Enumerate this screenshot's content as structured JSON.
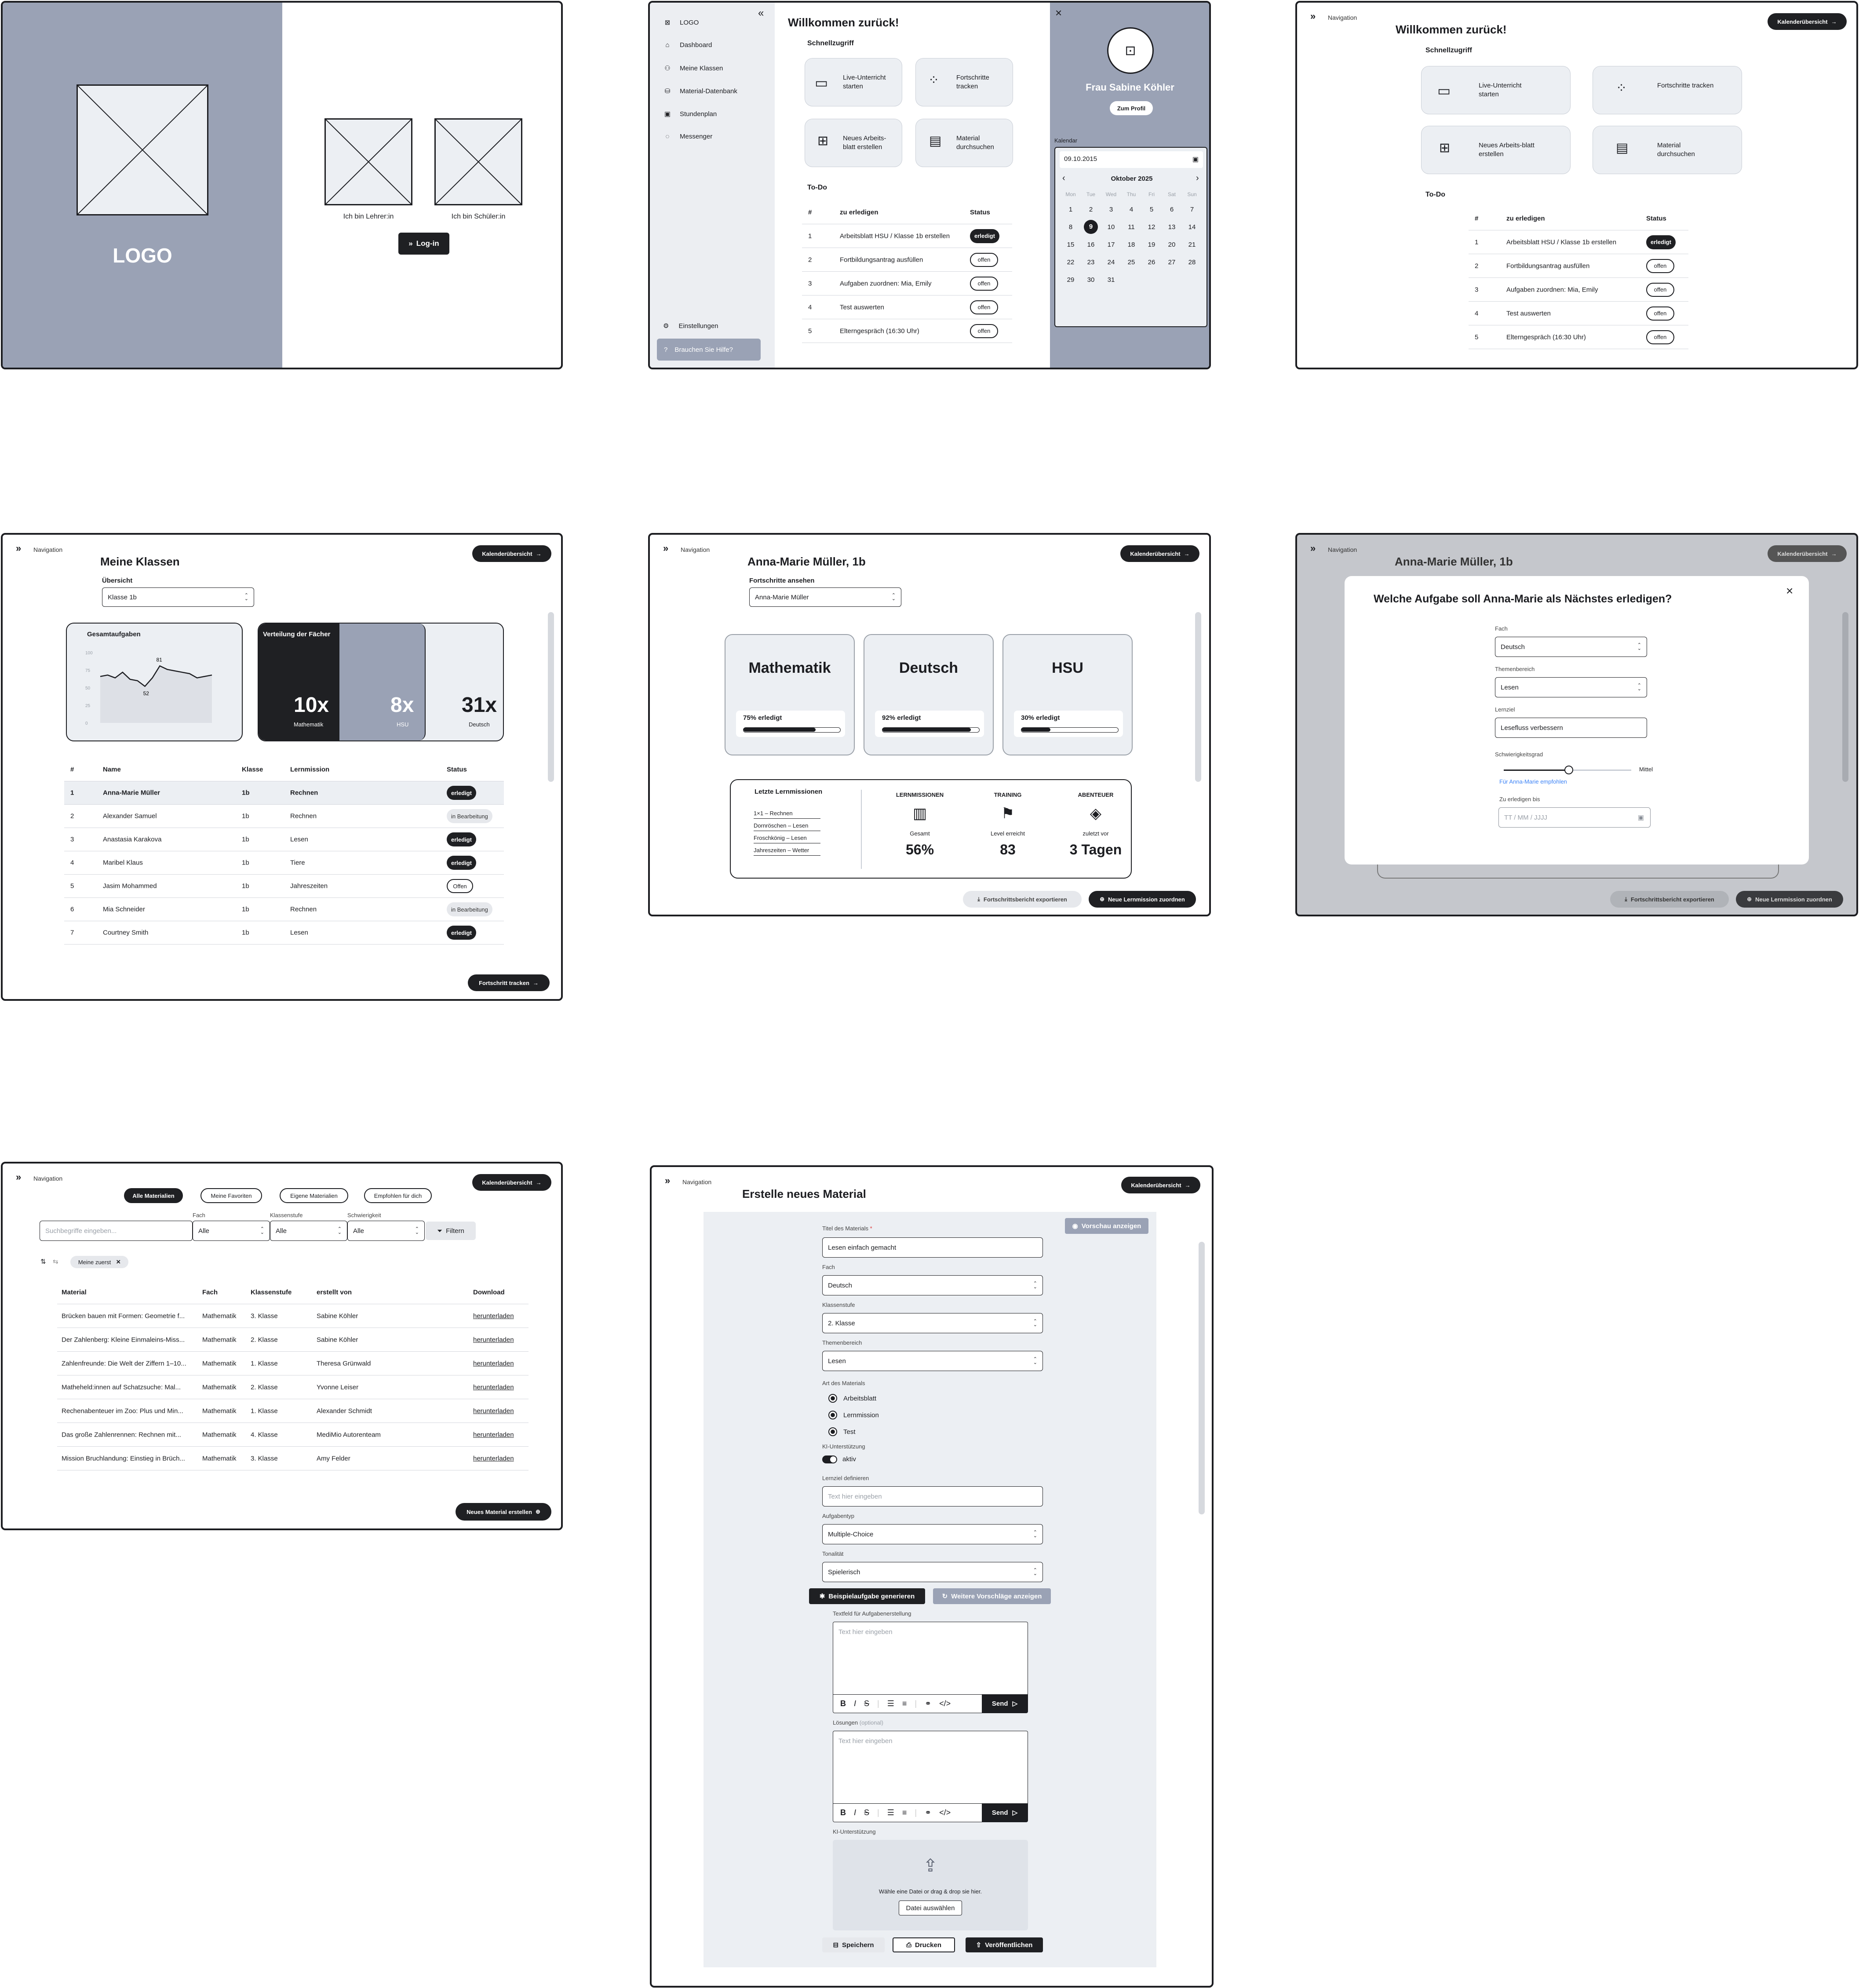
{
  "login": {
    "logo": "LOGO",
    "teacher": "Ich bin Lehrer:in",
    "student": "Ich bin Schüler:in",
    "login_btn": "Log-in"
  },
  "dash": {
    "sidebar": [
      "LOGO",
      "Dashboard",
      "Meine Klassen",
      "Material-Datenbank",
      "Stundenplan",
      "Messenger"
    ],
    "settings": "Einstellungen",
    "help": "Brauchen Sie Hilfe?",
    "welcome": "Willkommen zurück!",
    "quick": "Schnellzugriff",
    "tiles": [
      "Live-Unterricht starten",
      "Fortschritte tracken",
      "Neues Arbeits-blatt erstellen",
      "Material durchsuchen"
    ],
    "todo": "To-Do",
    "cols": [
      "#",
      "zu erledigen",
      "Status"
    ],
    "rows": [
      [
        "1",
        "Arbeitsblatt HSU / Klasse 1b erstellen",
        "erledigt"
      ],
      [
        "2",
        "Fortbildungsantrag ausfüllen",
        "offen"
      ],
      [
        "3",
        "Aufgaben zuordnen: Mia, Emily",
        "offen"
      ],
      [
        "4",
        "Test auswerten",
        "offen"
      ],
      [
        "5",
        "Elterngespräch (16:30 Uhr)",
        "offen"
      ]
    ],
    "profile_name": "Frau Sabine Köhler",
    "profile_btn": "Zum Profil",
    "kal": "Kalendar",
    "date": "09.10.2015",
    "month": "Oktober 2025",
    "days": [
      "Mon",
      "Tue",
      "Wed",
      "Thu",
      "Fri",
      "Sat",
      "Sun"
    ]
  },
  "nav": {
    "label": "Navigation",
    "cal_btn": "Kalenderübersicht"
  },
  "klassen": {
    "title": "Meine Klassen",
    "overview": "Übersicht",
    "class": "Klasse 1b",
    "total": "Gesamtaufgaben",
    "dist": "Verteilung der Fächer",
    "ticks": [
      "100",
      "75",
      "50",
      "25",
      "0"
    ],
    "peak": "81",
    "low": "52",
    "m": "10x",
    "m_l": "Mathematik",
    "h": "8x",
    "h_l": "HSU",
    "d": "31x",
    "d_l": "Deutsch",
    "cols": [
      "#",
      "Name",
      "Klasse",
      "Lernmission",
      "Status"
    ],
    "rows": [
      [
        "1",
        "Anna-Marie Müller",
        "1b",
        "Rechnen",
        "erledigt"
      ],
      [
        "2",
        "Alexander Samuel",
        "1b",
        "Rechnen",
        "in Bearbeitung"
      ],
      [
        "3",
        "Anastasia Karakova",
        "1b",
        "Lesen",
        "erledigt"
      ],
      [
        "4",
        "Maribel Klaus",
        "1b",
        "Tiere",
        "erledigt"
      ],
      [
        "5",
        "Jasim Mohammed",
        "1b",
        "Jahreszeiten",
        "Offen"
      ],
      [
        "6",
        "Mia Schneider",
        "1b",
        "Rechnen",
        "in Bearbeitung"
      ],
      [
        "7",
        "Courtney Smith",
        "1b",
        "Lesen",
        "erledigt"
      ]
    ],
    "track": "Fortschritt tracken"
  },
  "student": {
    "title": "Anna-Marie Müller, 1b",
    "sub": "Fortschritte ansehen",
    "sel": "Anna-Marie Müller",
    "subjects": [
      {
        "n": "Mathematik",
        "t": "75% erledigt",
        "v": 0.75
      },
      {
        "n": "Deutsch",
        "t": "92% erledigt",
        "v": 0.92
      },
      {
        "n": "HSU",
        "t": "30% erledigt",
        "v": 0.3
      }
    ],
    "last": "Letzte Lernmissionen",
    "missions": [
      "1×1 – Rechnen",
      "Dornröschen – Lesen",
      "Froschkönig – Lesen",
      "Jahreszeiten – Wetter"
    ],
    "stats": [
      {
        "h": "LERNMISSIONEN",
        "s": "Gesamt",
        "v": "56%"
      },
      {
        "h": "TRAINING",
        "s": "Level erreicht",
        "v": "83"
      },
      {
        "h": "ABENTEUER",
        "s": "zuletzt vor",
        "v": "3 Tagen"
      }
    ],
    "export": "Fortschrittsbericht exportieren",
    "assign": "Neue Lernmission zuordnen"
  },
  "modal": {
    "q": "Welche Aufgabe soll Anna-Marie als Nächstes erledigen?",
    "fach": "Fach",
    "fach_v": "Deutsch",
    "thema": "Themenbereich",
    "thema_v": "Lesen",
    "ziel": "Lernziel",
    "ziel_v": "Leseﬂuss verbessern",
    "diff": "Schwierigkeitsgrad",
    "diff_v": "Mittel",
    "rec": "Für Anna-Marie empfohlen",
    "until": "Zu erledigen bis",
    "date_ph": "TT / MM / JJJJ"
  },
  "mat": {
    "tabs": [
      "Alle Materialien",
      "Meine Favoriten",
      "Eigene Materialien",
      "Empfohlen für dich"
    ],
    "search": "Suchbegriffe eingeben...",
    "f_labels": [
      "Fach",
      "Klassenstufe",
      "Schwierigkeit"
    ],
    "all": "Alle",
    "filter": "Filtern",
    "chip": "Meine zuerst",
    "cols": [
      "Material",
      "Fach",
      "Klassenstufe",
      "erstellt von",
      "Download"
    ],
    "rows": [
      [
        "Brücken bauen mit Formen: Geometrie f...",
        "Mathematik",
        "3. Klasse",
        "Sabine Köhler",
        "herunterladen"
      ],
      [
        "Der Zahlenberg: Kleine Einmaleins-Miss...",
        "Mathematik",
        "2. Klasse",
        "Sabine Köhler",
        "herunterladen"
      ],
      [
        "Zahlenfreunde: Die Welt der Ziffern 1–10...",
        "Mathematik",
        "1. Klasse",
        "Theresa Grünwald",
        "herunterladen"
      ],
      [
        "Matheheld:innen auf Schatzsuche: Mal...",
        "Mathematik",
        "2. Klasse",
        "Yvonne Leiser",
        "herunterladen"
      ],
      [
        "Rechenabenteuer im Zoo: Plus und Min...",
        "Mathematik",
        "1. Klasse",
        "Alexander Schmidt",
        "herunterladen"
      ],
      [
        "Das große Zahlenrennen: Rechnen mit...",
        "Mathematik",
        "4. Klasse",
        "MediMio Autorenteam",
        "herunterladen"
      ],
      [
        "Mission Bruchlandung: Einstieg in Brüch...",
        "Mathematik",
        "3. Klasse",
        "Amy Felder",
        "herunterladen"
      ]
    ],
    "new": "Neues Material erstellen"
  },
  "create": {
    "title": "Erstelle neues Material",
    "preview": "Vorschau anzeigen",
    "t_lbl": "Titel des Materials",
    "t_v": "Lesen einfach gemacht",
    "fach": "Fach",
    "fach_v": "Deutsch",
    "ks": "Klassenstufe",
    "ks_v": "2. Klasse",
    "th": "Themenbereich",
    "th_v": "Lesen",
    "art": "Art des Materials",
    "arts": [
      "Arbeitsblatt",
      "Lernmission",
      "Test"
    ],
    "ki": "KI-Unterstützung",
    "ki_v": "aktiv",
    "lz": "Lernziel definieren",
    "ph": "Text hier eingeben",
    "typ": "Aufgabentyp",
    "typ_v": "Multiple-Choice",
    "ton": "Tonalität",
    "ton_v": "Spielerisch",
    "gen": "Beispielaufgabe generieren",
    "more": "Weitere Vorschläge anzeigen",
    "tf": "Textfeld für Aufgabenerstellung",
    "send": "Send",
    "loes": "Lösungen",
    "opt": "(optional)",
    "ki2": "KI-Unterstützung",
    "drop": "Wähle eine Datei or drag & drop sie hier.",
    "choose": "Datei auswählen",
    "save": "Speichern",
    "print": "Drucken",
    "pub": "Veröffentlichen"
  }
}
